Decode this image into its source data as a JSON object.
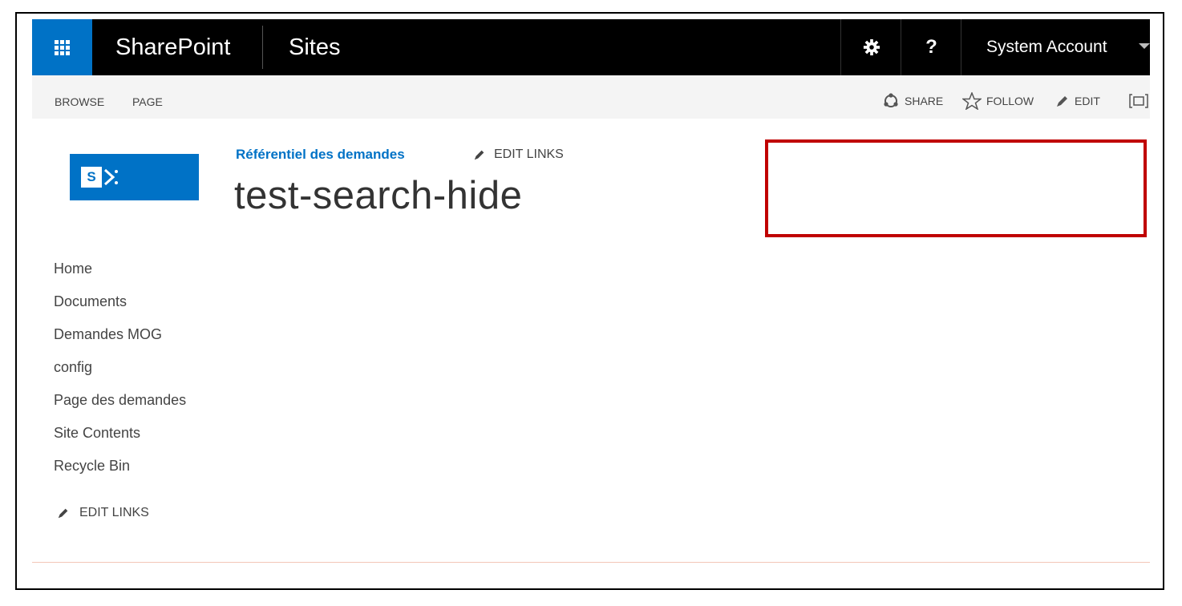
{
  "suite_bar": {
    "app_launcher_icon": "waffle-icon",
    "brand": "SharePoint",
    "sites_label": "Sites",
    "settings_icon": "gear-icon",
    "help_label": "?",
    "account_name": "System Account",
    "colors": {
      "bar": "#000000",
      "launcher": "#0072c6"
    }
  },
  "ribbon": {
    "tabs": [
      "BROWSE",
      "PAGE"
    ],
    "actions": {
      "share": "SHARE",
      "follow": "FOLLOW",
      "edit": "EDIT"
    }
  },
  "header": {
    "breadcrumb_link": "Référentiel des demandes",
    "edit_links": "EDIT LINKS",
    "page_title": "test-search-hide"
  },
  "quick_launch": {
    "items": [
      "Home",
      "Documents",
      "Demandes MOG",
      "config",
      "Page des demandes",
      "Site Contents",
      "Recycle Bin"
    ],
    "edit_links": "EDIT LINKS"
  },
  "highlight": {
    "color": "#c00000"
  }
}
